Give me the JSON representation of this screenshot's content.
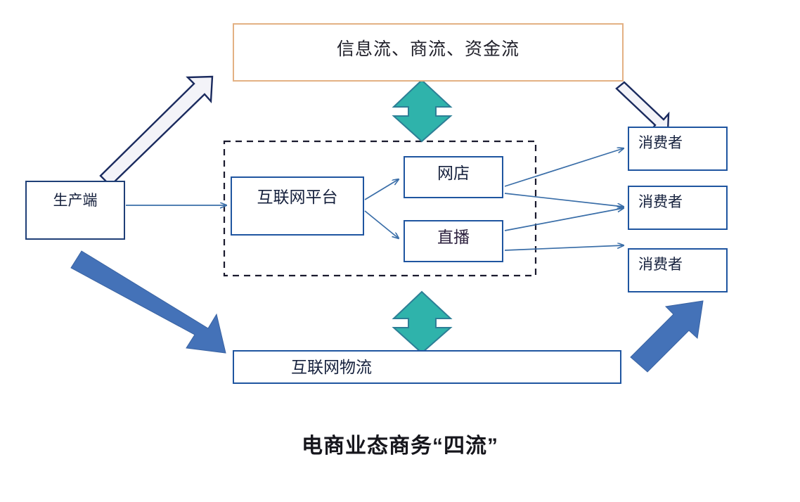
{
  "diagram": {
    "caption": "电商业态商务“四流”",
    "nodes": {
      "info_flow": {
        "label": "信息流、商流、资金流",
        "border_color": "#e3b183"
      },
      "producer": {
        "label": "生产端",
        "border_color": "#1f3f77"
      },
      "platform": {
        "label": "互联网平台",
        "border_color": "#1f55a0"
      },
      "online_shop": {
        "label": "网店",
        "border_color": "#1f55a0"
      },
      "livestream": {
        "label": "直播",
        "border_color": "#1f55a0"
      },
      "consumer_1": {
        "label": "消费者",
        "border_color": "#1f55a0"
      },
      "consumer_2": {
        "label": "消费者",
        "border_color": "#1f55a0"
      },
      "consumer_3": {
        "label": "消费者",
        "border_color": "#1f55a0"
      },
      "logistics": {
        "label": "互联网物流",
        "border_color": "#1f55a0"
      }
    },
    "groups": {
      "platform_group": {
        "style": "dashed-rectangle",
        "border_color": "#1a1a2e"
      }
    },
    "connectors": {
      "thin_blue": {
        "color": "#3a6ea8",
        "style": "thin-arrow"
      },
      "thick_blue": {
        "color": "#4472b8",
        "style": "thick-block-arrow"
      },
      "teal_double": {
        "fill": "#2fb3ab",
        "stroke": "#1f6f8f",
        "style": "double-headed-vertical-arrow"
      },
      "hollow_outline": {
        "fill": "#f4f4f8",
        "stroke": "#1a2a5e",
        "style": "hollow-block-arrow"
      }
    },
    "edges": [
      {
        "from": "producer",
        "to": "platform",
        "connector": "thin_blue"
      },
      {
        "from": "platform",
        "to": "online_shop",
        "connector": "thin_blue"
      },
      {
        "from": "platform",
        "to": "livestream",
        "connector": "thin_blue"
      },
      {
        "from": "online_shop",
        "to": "consumer_1",
        "connector": "thin_blue"
      },
      {
        "from": "online_shop",
        "to": "consumer_2",
        "connector": "thin_blue"
      },
      {
        "from": "livestream",
        "to": "consumer_2",
        "connector": "thin_blue"
      },
      {
        "from": "livestream",
        "to": "consumer_3",
        "connector": "thin_blue"
      },
      {
        "from": "producer",
        "to": "info_flow",
        "connector": "hollow_outline"
      },
      {
        "from": "info_flow",
        "to": "consumer_1",
        "connector": "hollow_outline"
      },
      {
        "from": "info_flow",
        "to": "platform_group",
        "connector": "teal_double"
      },
      {
        "from": "platform_group",
        "to": "logistics",
        "connector": "teal_double"
      },
      {
        "from": "producer",
        "to": "logistics",
        "connector": "thick_blue"
      },
      {
        "from": "logistics",
        "to": "consumer_3",
        "connector": "thick_blue"
      }
    ]
  }
}
